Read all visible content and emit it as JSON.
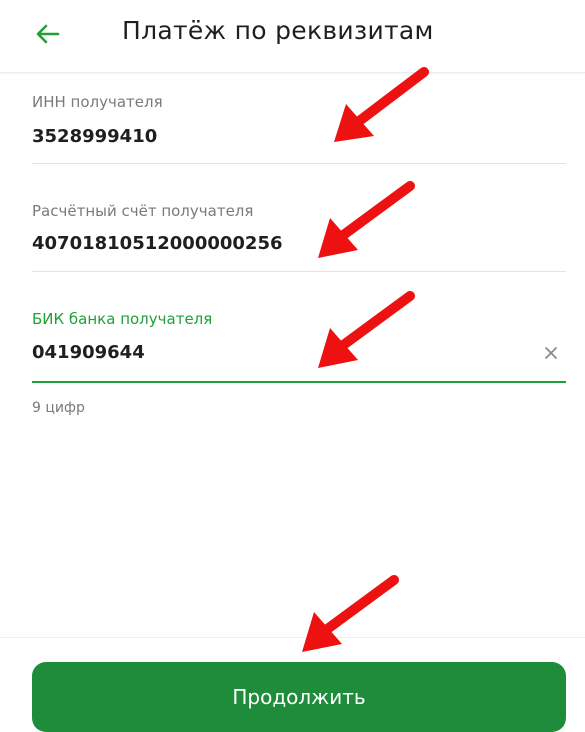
{
  "header": {
    "back_icon": "arrow-left-icon",
    "title": "Платёж по реквизитам"
  },
  "form": {
    "inn": {
      "label": "ИНН получателя",
      "value": "3528999410"
    },
    "account": {
      "label": "Расчётный счёт получателя",
      "value": "40701810512000000256"
    },
    "bik": {
      "label": "БИК банка получателя",
      "value": "041909644",
      "hint": "9 цифр",
      "clear_icon": "close-icon"
    }
  },
  "footer": {
    "continue_label": "Продолжить"
  },
  "annotations": {
    "arrow_icon": "red-arrow-icon",
    "arrow_color": "#ee1111"
  },
  "colors": {
    "accent": "#21a038",
    "button": "#1e8c3a"
  }
}
